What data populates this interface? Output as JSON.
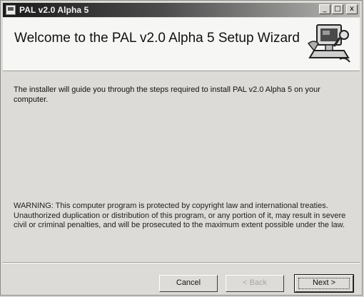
{
  "window": {
    "title": "PAL v2.0 Alpha 5",
    "controls": {
      "minimize": "_",
      "maximize": "□",
      "close": "x"
    }
  },
  "header": {
    "title": "Welcome to the PAL v2.0 Alpha 5 Setup Wizard",
    "icon": "computer-setup-icon"
  },
  "main": {
    "intro": "The installer will guide you through the steps required to install PAL v2.0 Alpha 5 on your computer.",
    "warning": "WARNING: This computer program is protected by copyright law and international treaties. Unauthorized duplication or distribution of this program, or any portion of it, may result in severe civil or criminal penalties, and will be prosecuted to the maximum extent possible under the law."
  },
  "buttons": {
    "cancel": "Cancel",
    "back": "< Back",
    "next": "Next >"
  }
}
